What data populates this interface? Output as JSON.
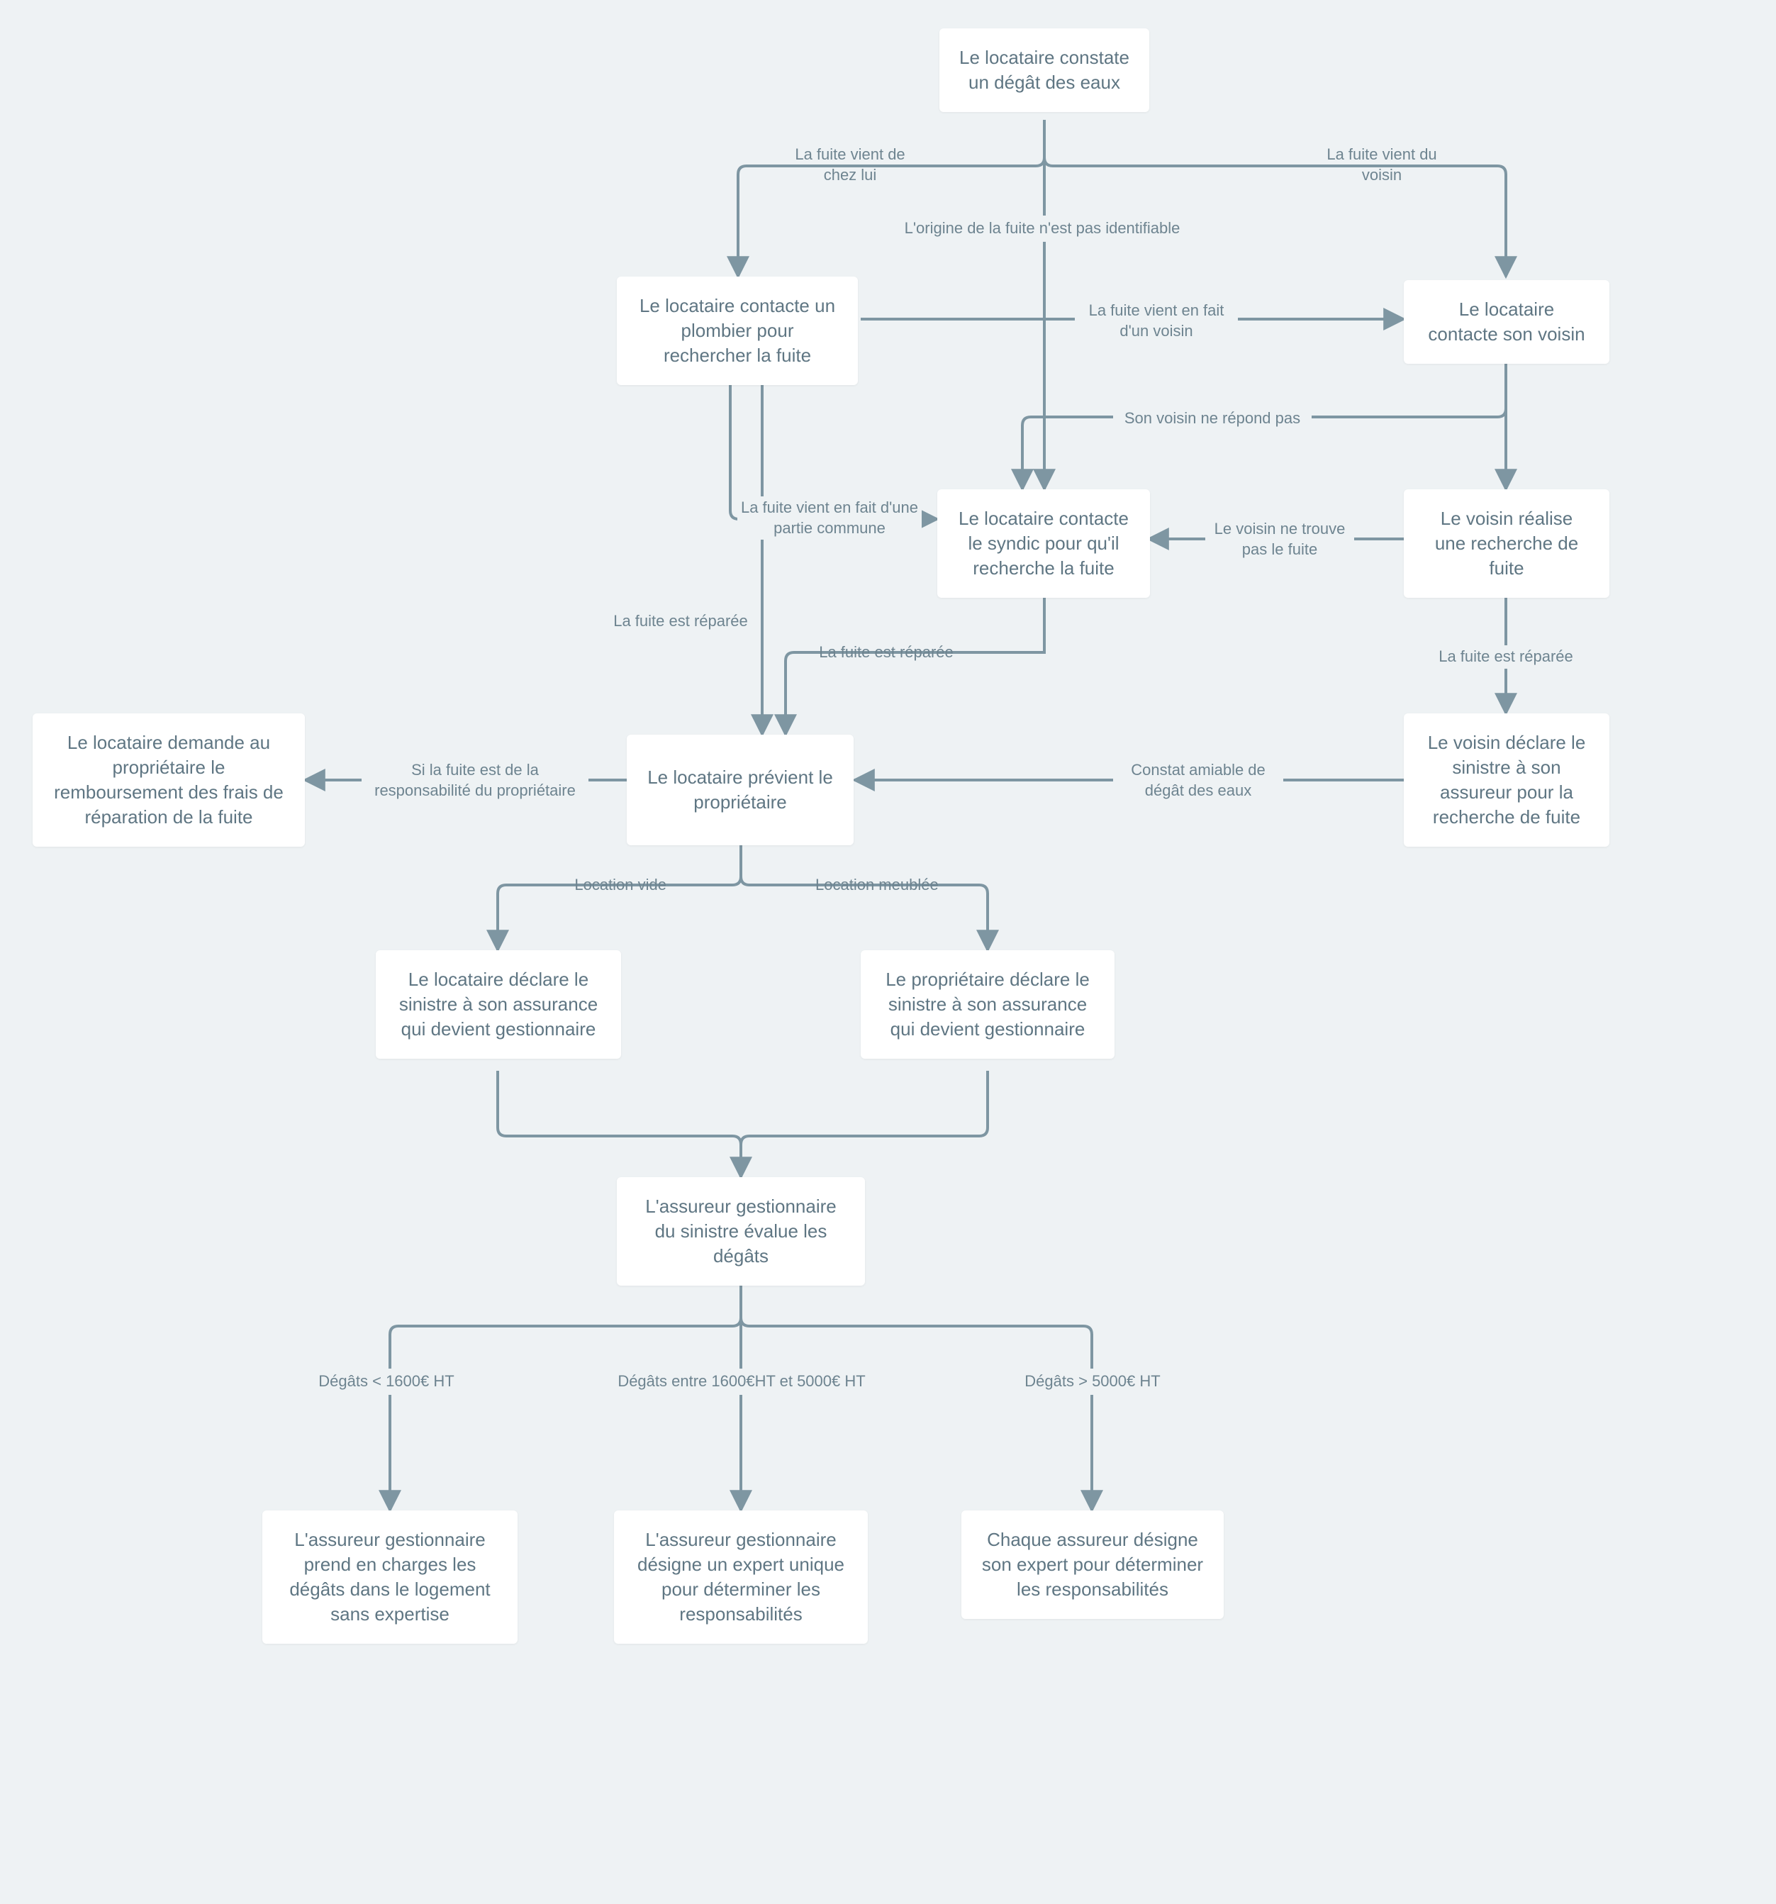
{
  "palette": {
    "bg": "#eef2f4",
    "nodeBg": "#ffffff",
    "text": "#5f7683",
    "stroke": "#7e96a2"
  },
  "nodes": {
    "n1": {
      "text": "Le locataire constate un dégât des eaux"
    },
    "n2": {
      "text": "Le locataire contacte un plombier pour rechercher la fuite"
    },
    "n3": {
      "text": "Le locataire contacte son voisin"
    },
    "n4": {
      "text": "Le voisin réalise une recherche de fuite"
    },
    "n5": {
      "text": "Le locataire contacte le syndic pour qu'il recherche la fuite"
    },
    "n6": {
      "text": "Le voisin déclare le sinistre à son assureur pour la recherche de fuite"
    },
    "n7": {
      "text": "Le locataire prévient le propriétaire"
    },
    "n8": {
      "text": "Le locataire demande au propriétaire le remboursement des frais de réparation de la fuite"
    },
    "n9": {
      "text": "Le locataire déclare le sinistre à son assurance qui devient gestionnaire"
    },
    "n10": {
      "text": "Le propriétaire déclare le sinistre à son assurance qui devient gestionnaire"
    },
    "n11": {
      "text": "L'assureur gestionnaire du sinistre évalue les dégâts"
    },
    "n12": {
      "text": "L'assureur gestionnaire prend en charges les dégâts dans le logement sans expertise"
    },
    "n13": {
      "text": "L'assureur gestionnaire désigne un expert unique pour déterminer les responsabilités"
    },
    "n14": {
      "text": "Chaque assureur désigne son expert pour déterminer les responsabilités"
    }
  },
  "edges": {
    "e1": {
      "text": "La fuite vient de chez lui"
    },
    "e2": {
      "text": "La fuite vient du voisin"
    },
    "e3": {
      "text": "L'origine de la fuite n'est pas identifiable"
    },
    "e4": {
      "text": "La fuite vient en fait d'un voisin"
    },
    "e5": {
      "text": "Son voisin ne répond pas"
    },
    "e6": {
      "text": "Le voisin ne trouve pas le fuite"
    },
    "e7": {
      "text": "La fuite vient en fait d'une partie commune"
    },
    "e8": {
      "text": "La fuite est réparée"
    },
    "e9": {
      "text": "La fuite est réparée"
    },
    "e10": {
      "text": "La fuite est réparée"
    },
    "e11": {
      "text": "Constat amiable de dégât des eaux"
    },
    "e12": {
      "text": "Si la fuite est de la responsabilité du propriétaire"
    },
    "e13": {
      "text": "Location vide"
    },
    "e14": {
      "text": "Location meublée"
    },
    "e15": {
      "text": "Dégâts < 1600€ HT"
    },
    "e16": {
      "text": "Dégâts entre 1600€HT et 5000€ HT"
    },
    "e17": {
      "text": "Dégâts > 5000€ HT"
    }
  }
}
